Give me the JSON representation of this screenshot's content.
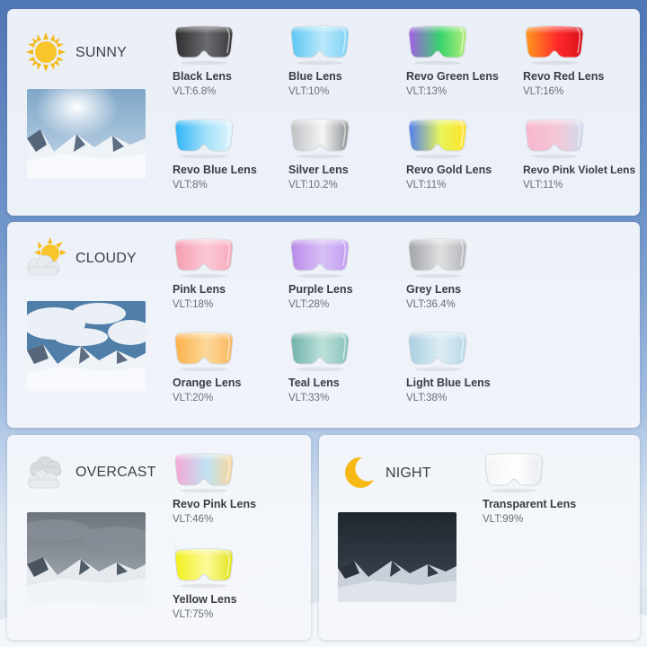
{
  "sections": {
    "sunny": {
      "label": "SUNNY",
      "icon": "sun-icon",
      "lenses": [
        {
          "name": "Black Lens",
          "vlt": "VLT:6.8%",
          "colors": [
            "#2e2e30",
            "#6c6c70",
            "#3a3a3d"
          ]
        },
        {
          "name": "Blue Lens",
          "vlt": "VLT:10%",
          "colors": [
            "#5cc6f2",
            "#b9e8fb",
            "#7fd2f6"
          ]
        },
        {
          "name": "Revo Green Lens",
          "vlt": "VLT:13%",
          "colors": [
            "#a35ee6",
            "#38d46a",
            "#b6f07a"
          ]
        },
        {
          "name": "Revo Red Lens",
          "vlt": "VLT:16%",
          "colors": [
            "#ff9a1f",
            "#ff2a2a",
            "#d8101a"
          ]
        },
        {
          "name": "Revo Blue Lens",
          "vlt": "VLT:8%",
          "colors": [
            "#2fb4f5",
            "#a6e2fb",
            "#dff4fd"
          ]
        },
        {
          "name": "Silver Lens",
          "vlt": "VLT:10.2%",
          "colors": [
            "#bfc1c4",
            "#f4f5f6",
            "#8e9194"
          ]
        },
        {
          "name": "Revo Gold Lens",
          "vlt": "VLT:11%",
          "colors": [
            "#4f7ef0",
            "#e8f55a",
            "#ffe12a"
          ]
        },
        {
          "name": "Revo Pink Violet Lens",
          "vlt": "VLT:11%",
          "colors": [
            "#f7b8cf",
            "#f3c6d6",
            "#d0dcef"
          ]
        }
      ]
    },
    "cloudy": {
      "label": "CLOUDY",
      "icon": "sun-behind-cloud-icon",
      "lenses": [
        {
          "name": "Pink Lens",
          "vlt": "VLT:18%",
          "colors": [
            "#f59cb0",
            "#fbc9d5",
            "#f7a9bb"
          ]
        },
        {
          "name": "Purple Lens",
          "vlt": "VLT:28%",
          "colors": [
            "#b88ae8",
            "#d8c0f7",
            "#c19cf0"
          ]
        },
        {
          "name": "Grey Lens",
          "vlt": "VLT:36.4%",
          "colors": [
            "#a2a4a7",
            "#dedfe1",
            "#b3b5b8"
          ]
        },
        {
          "name": "Orange Lens",
          "vlt": "VLT:20%",
          "colors": [
            "#fcb14a",
            "#fdd89a",
            "#f9b75e"
          ]
        },
        {
          "name": "Teal Lens",
          "vlt": "VLT:33%",
          "colors": [
            "#6fb3ab",
            "#bde0d9",
            "#86c2ba"
          ]
        },
        {
          "name": "Light Blue Lens",
          "vlt": "VLT:38%",
          "colors": [
            "#a9cfe0",
            "#dcedf4",
            "#b9d8e6"
          ]
        }
      ]
    },
    "overcast": {
      "label": "OVERCAST",
      "icon": "cloud-icon",
      "lenses": [
        {
          "name": "Revo Pink Lens",
          "vlt": "VLT:46%",
          "colors": [
            "#f5a7d3",
            "#bfe3f3",
            "#f9d59a"
          ]
        },
        {
          "name": "Yellow Lens",
          "vlt": "VLT:75%",
          "colors": [
            "#f2f01a",
            "#fbfa9a",
            "#e3e31e"
          ]
        }
      ]
    },
    "night": {
      "label": "NIGHT",
      "icon": "crescent-moon-icon",
      "lenses": [
        {
          "name": "Transparent Lens",
          "vlt": "VLT:99%",
          "colors": [
            "#f4f5f7",
            "#ffffff",
            "#e7e9ed"
          ]
        }
      ]
    }
  },
  "colors": {
    "panel": "#f4f7fb",
    "label_text": "#3c3f44",
    "vlt_text": "#6a6e74",
    "sun": "#f6b915",
    "moon": "#f6b915"
  }
}
